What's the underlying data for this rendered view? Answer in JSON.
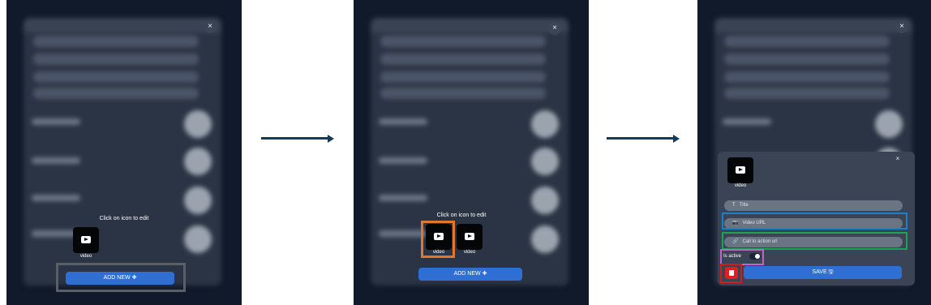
{
  "steps": [
    {
      "hint": "Click on icon to edit",
      "tile_label": "video",
      "add_button": "ADD NEW ✚",
      "close": "×"
    },
    {
      "hint": "Click on icon to edit",
      "tile_labels": [
        "video",
        "video"
      ],
      "add_button": "ADD NEW ✚",
      "close": "×"
    },
    {
      "close": "×",
      "editor": {
        "close": "×",
        "tile_label": "video",
        "fields": [
          {
            "icon": "T",
            "label": "Title"
          },
          {
            "icon": "📷",
            "label": "Video URL"
          },
          {
            "icon": "🔗",
            "label": "Call to action url"
          }
        ],
        "active_label": "Is active",
        "save_button": "SAVE 🖫"
      }
    }
  ],
  "highlight_colors": {
    "add_new": "#5a5f66",
    "icon_select": "#e2762a",
    "video_url": "#1c7fc9",
    "cta_url": "#1aa35a",
    "toggle": "#c063c4",
    "delete": "#d11c1c"
  }
}
